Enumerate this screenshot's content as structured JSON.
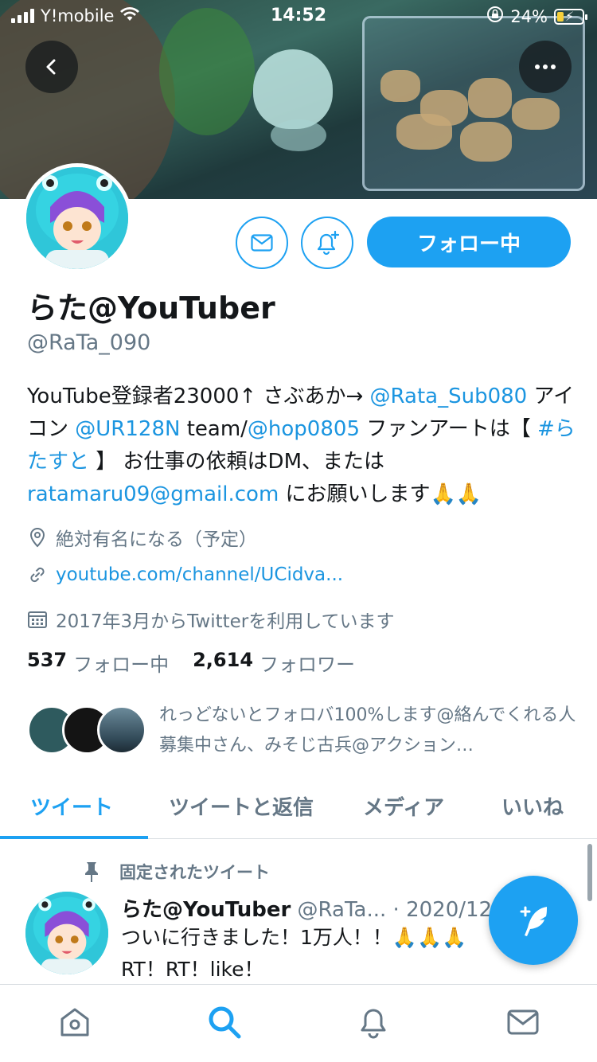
{
  "status_bar": {
    "carrier": "Y!mobile",
    "time": "14:52",
    "battery": "24%"
  },
  "profile": {
    "name": "らた@YouTuber",
    "handle": "@RaTa_090",
    "follow_label": "フォロー中",
    "bio": [
      {
        "text": "YouTube登録者23000↑ さぶあか→ "
      },
      {
        "text": "@Rata_Sub080",
        "link": true
      },
      {
        "text": " アイコン "
      },
      {
        "text": "@UR128N",
        "link": true
      },
      {
        "text": " team/"
      },
      {
        "text": "@hop0805",
        "link": true
      },
      {
        "text": " ファンアートは【 "
      },
      {
        "text": "#らたすと",
        "link": true
      },
      {
        "text": " 】 お仕事の依頼はDM、または "
      },
      {
        "text": "ratamaru09@gmail.com",
        "link": true
      },
      {
        "text": " にお願いします🙏🙏"
      }
    ],
    "location": "絶対有名になる（予定）",
    "url": "youtube.com/channel/UCidva...",
    "joined": "2017年3月からTwitterを利用しています",
    "following_count": "537",
    "following_label": "フォロー中",
    "followers_count": "2,614",
    "followers_label": "フォロワー",
    "followed_by": "れっどないとフォロバ100%します@絡んでくれる人募集中さん、みそじ古兵@アクション…"
  },
  "tabs": [
    {
      "label": "ツイート",
      "active": true
    },
    {
      "label": "ツイートと返信",
      "active": false
    },
    {
      "label": "メディア",
      "active": false
    },
    {
      "label": "いいね",
      "active": false
    }
  ],
  "pinned_tweet": {
    "pin_label": "固定されたツイート",
    "author": "らた@YouTuber",
    "handle_date": "@RaTa... · 2020/12",
    "text_line1": "ついに行きました！1万人！！🙏🙏🙏",
    "text_line2": "RT！RT！like！"
  },
  "icons": {
    "back": "chevron-left-icon",
    "more": "more-horizontal-icon",
    "message": "envelope-icon",
    "notify": "bell-plus-icon",
    "location": "location-pin-icon",
    "link": "link-icon",
    "calendar": "calendar-icon",
    "pin": "pin-icon",
    "compose": "compose-tweet-icon",
    "home": "home-icon",
    "search": "search-icon",
    "notifications": "bell-icon",
    "messages": "mail-icon"
  },
  "colors": {
    "accent": "#1da1f2",
    "link": "#1b95e0",
    "secondary_text": "#657786"
  }
}
